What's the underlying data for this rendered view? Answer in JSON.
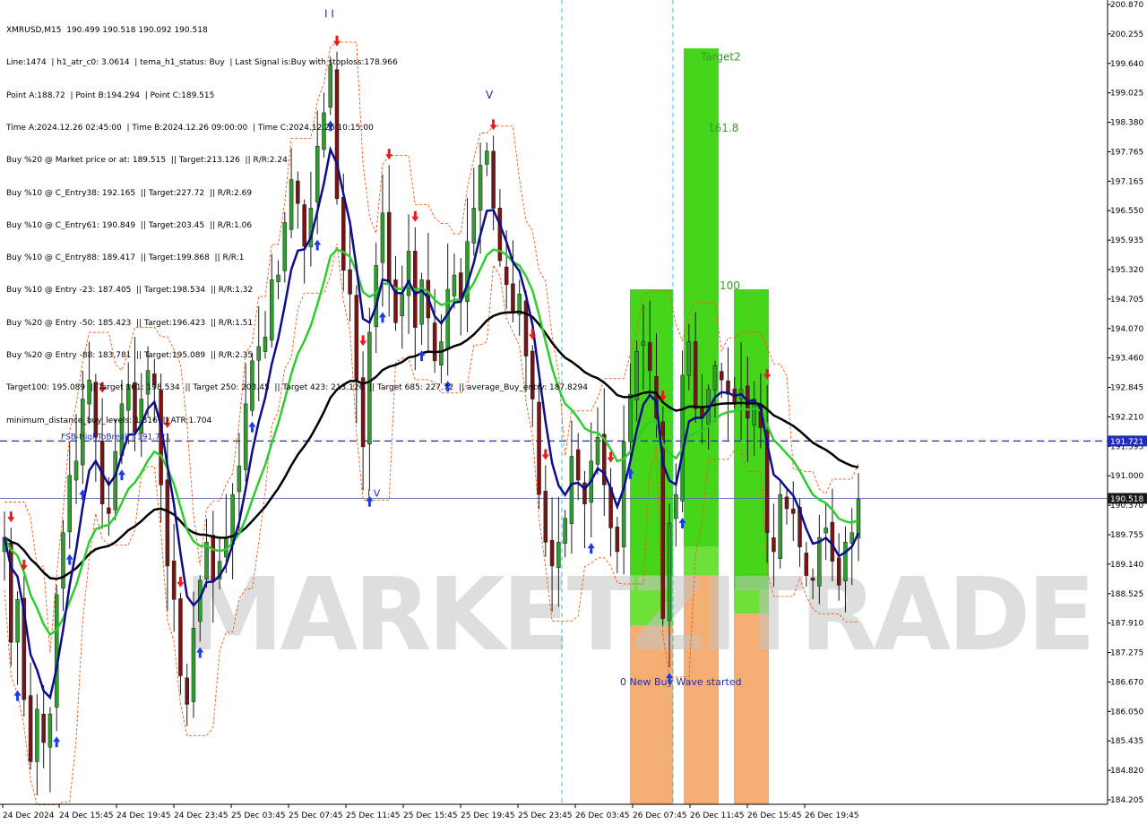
{
  "header": {
    "lines": [
      "XMRUSD,M15  190.499 190.518 190.092 190.518",
      "Line:1474  | h1_atr_c0: 3.0614  | tema_h1_status: Buy  | Last Signal is:Buy with stoploss:178.966",
      "Point A:188.72  | Point B:194.294  | Point C:189.515",
      "Time A:2024.12.26 02:45:00  | Time B:2024.12.26 09:00:00  | Time C:2024.12.26 10:15:00",
      "Buy %20 @ Market price or at: 189.515  || Target:213.126  || R/R:2.24",
      "Buy %10 @ C_Entry38: 192.165  || Target:227.72  || R/R:2.69",
      "Buy %10 @ C_Entry61: 190.849  || Target:203.45  || R/R:1.06",
      "Buy %10 @ C_Entry88: 189.417  || Target:199.868  || R/R:1",
      "Buy %10 @ Entry -23: 187.405  || Target:198.534  || R/R:1.32",
      "Buy %20 @ Entry -50: 185.423  || Target:196.423  || R/R:1.51",
      "Buy %20 @ Entry -88: 183.781  || Target:195.089  || R/R:2.35",
      "Target100: 195.089  || Target 161: 198.534  || Target 250: 203.45  || Target 423: 213.126  || Target 685: 227.72  || average_Buy_entry: 187.8294",
      "minimum_distance_buy_levels: 1.316  || ATR:1.704"
    ]
  },
  "watermark": "MARKETZITRADE",
  "colors": {
    "accent_blue": "#1f2db8",
    "navy_line": "#0d0d8c",
    "green_line": "#2ecc2e",
    "black_line": "#000000",
    "orange_dashed": "#f05a14",
    "green_zone": "#45d61c",
    "orange_zone": "#f2a05a",
    "price_tag": "#1a1a1a",
    "fsb_tag": "#1f2db8"
  },
  "chart_data": {
    "type": "candlestick",
    "symbol": "XMRUSD",
    "timeframe": "M15",
    "ylim": [
      184.2,
      200.87
    ],
    "y_ticks": [
      "200.870",
      "200.255",
      "199.640",
      "199.025",
      "198.380",
      "197.765",
      "197.165",
      "196.550",
      "195.935",
      "195.320",
      "194.705",
      "194.070",
      "193.460",
      "192.845",
      "192.210",
      "191.595",
      "191.000",
      "190.370",
      "189.755",
      "189.140",
      "188.525",
      "187.910",
      "187.275",
      "186.670",
      "186.050",
      "185.435",
      "184.820",
      "184.205"
    ],
    "x_ticks": [
      "24 Dec 2024",
      "24 Dec 15:45",
      "24 Dec 19:45",
      "24 Dec 23:45",
      "25 Dec 03:45",
      "25 Dec 07:45",
      "25 Dec 11:45",
      "25 Dec 15:45",
      "25 Dec 19:45",
      "25 Dec 23:45",
      "26 Dec 03:45",
      "26 Dec 07:45",
      "26 Dec 11:45",
      "26 Dec 15:45",
      "26 Dec 19:45"
    ],
    "current_price": 190.518,
    "current_price_label": "190.518",
    "fsb_level": 191.721,
    "fsb_label": "FSB-HighToBreak | 191.721",
    "fsb_tag": "191.721",
    "annotations": [
      {
        "text": "Target2",
        "price": 199.7
      },
      {
        "text": "161.8",
        "price": 198.2
      },
      {
        "text": "100",
        "price": 194.9
      },
      {
        "text": "0 New Buy Wave started",
        "price": 186.6
      },
      {
        "text": "I V",
        "price": 190.55
      },
      {
        "text": "V",
        "price": 198.9
      },
      {
        "text": "I I",
        "price": 200.6
      }
    ],
    "closes": [
      189.7,
      187.5,
      188.4,
      186.3,
      185.0,
      186.1,
      185.4,
      186.0,
      188.5,
      189.8,
      191.0,
      191.3,
      192.6,
      193.0,
      191.8,
      190.4,
      190.2,
      191.5,
      192.5,
      192.9,
      191.9,
      192.6,
      193.2,
      192.9,
      190.8,
      189.1,
      188.4,
      186.8,
      186.2,
      187.8,
      188.8,
      189.6,
      188.8,
      189.2,
      189.7,
      190.6,
      191.2,
      192.5,
      193.4,
      193.7,
      193.9,
      195.1,
      195.2,
      196.3,
      197.2,
      196.7,
      195.8,
      196.6,
      197.9,
      198.6,
      199.6,
      196.8,
      195.3,
      194.8,
      193.0,
      191.6,
      194.0,
      195.4,
      196.5,
      195.0,
      194.2,
      194.8,
      195.7,
      194.1,
      195.1,
      194.3,
      193.4,
      193.8,
      194.9,
      195.2,
      194.7,
      195.9,
      196.6,
      197.5,
      197.8,
      196.6,
      195.5,
      195.0,
      194.4,
      194.8,
      193.5,
      192.6,
      190.6,
      189.6,
      189.1,
      189.6,
      190.1,
      191.4,
      190.9,
      190.4,
      191.3,
      191.8,
      190.8,
      189.9,
      189.4,
      191.7,
      192.7,
      193.6,
      193.8,
      193.2,
      192.2,
      188.0,
      190.0,
      190.6,
      193.1,
      193.8,
      192.4,
      192.2,
      192.8,
      193.3,
      193.0,
      192.7,
      192.5,
      192.8,
      192.2,
      192.6,
      192.0,
      189.8,
      189.4,
      190.6,
      190.3,
      190.2,
      189.5,
      188.9,
      188.8,
      189.7,
      189.9,
      189.2,
      188.7,
      189.6,
      189.8,
      190.5
    ]
  }
}
